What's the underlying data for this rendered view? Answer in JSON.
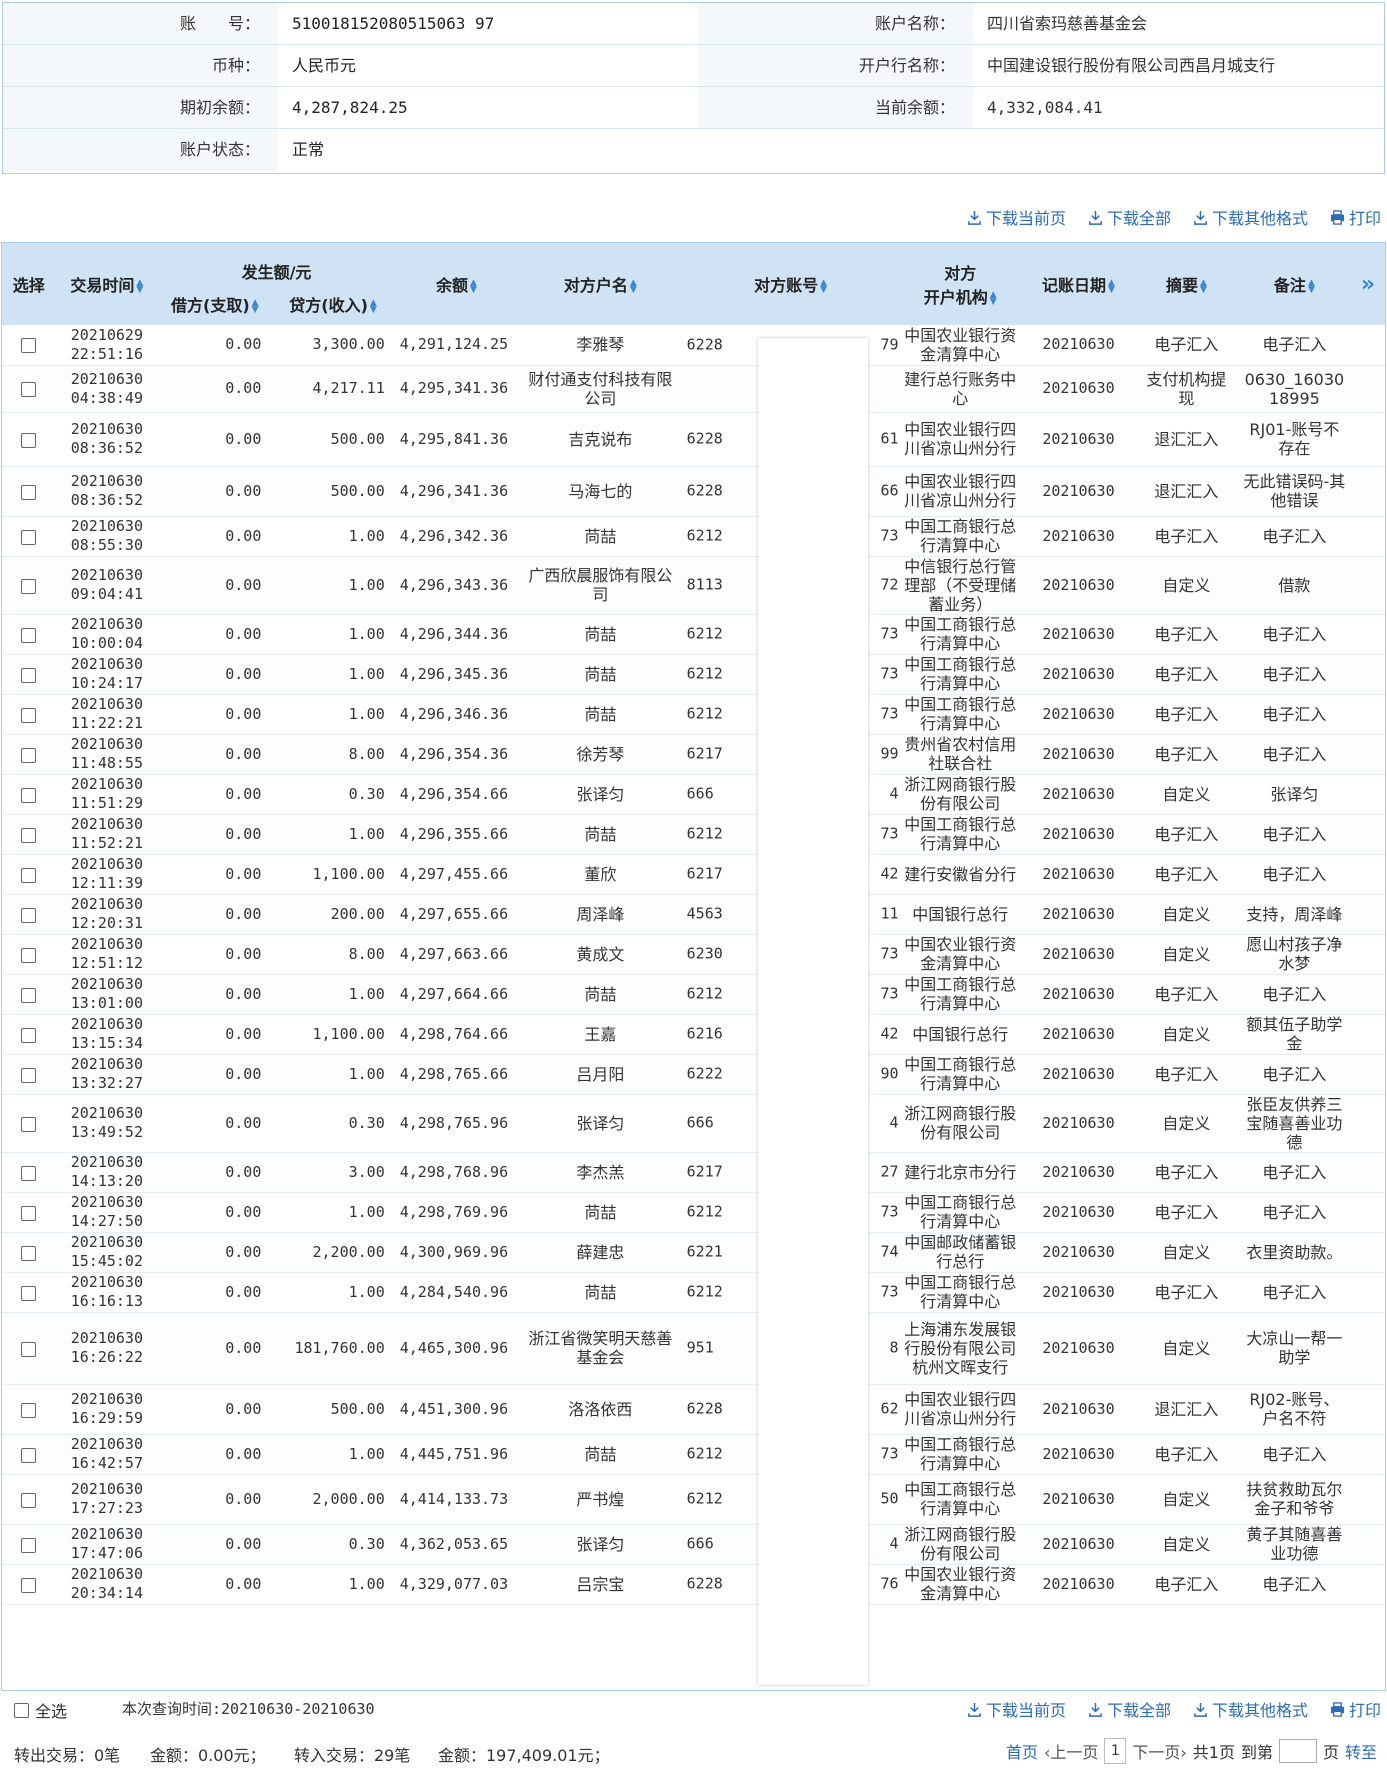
{
  "account": {
    "no_label": "账　　号：",
    "no_value": "510018152080515063 97",
    "name_label": "账户名称：",
    "name_value": "四川省索玛慈善基金会",
    "currency_label": "币种：",
    "currency_value": "人民币元",
    "bank_label": "开户行名称：",
    "bank_value": "中国建设银行股份有限公司西昌月城支行",
    "opening_label": "期初余额：",
    "opening_value": "4,287,824.25",
    "current_label": "当前余额：",
    "current_value": "4,332,084.41",
    "status_label": "账户状态：",
    "status_value": "正常"
  },
  "toolbar": {
    "download_page": "下载当前页",
    "download_all": "下载全部",
    "download_other": "下载其他格式",
    "print": "打印"
  },
  "table": {
    "headers": {
      "select": "选择",
      "time": "交易时间",
      "amount_group": "发生额/元",
      "debit": "借方(支取)",
      "credit": "贷方(收入)",
      "balance": "余额",
      "party": "对方户名",
      "party_account": "对方账号",
      "party_bank_1": "对方",
      "party_bank_2": "开户机构",
      "book_date": "记账日期",
      "summary": "摘要",
      "remark": "备注",
      "more": "»"
    },
    "rows": [
      {
        "d": "20210629",
        "t": "22:51:16",
        "debit": "0.00",
        "credit": "3,300.00",
        "bal": "4,291,124.25",
        "party": "李雅琴",
        "acct_l": "6228",
        "acct_r": "79",
        "bank": "中国农业银行资金清算中心",
        "date": "20210630",
        "sum": "电子汇入",
        "rem": "电子汇入"
      },
      {
        "d": "20210630",
        "t": "04:38:49",
        "debit": "0.00",
        "credit": "4,217.11",
        "bal": "4,295,341.36",
        "party": "财付通支付科技有限公司",
        "acct_l": "",
        "acct_r": "",
        "bank": "建行总行账务中心",
        "date": "20210630",
        "sum": "支付机构提现",
        "rem": "0630_16030 18995"
      },
      {
        "d": "20210630",
        "t": "08:36:52",
        "debit": "0.00",
        "credit": "500.00",
        "bal": "4,295,841.36",
        "party": "吉克说布",
        "acct_l": "6228",
        "acct_r": "61",
        "bank": "中国农业银行四川省凉山州分行",
        "date": "20210630",
        "sum": "退汇汇入",
        "rem": "RJ01-账号不存在"
      },
      {
        "d": "20210630",
        "t": "08:36:52",
        "debit": "0.00",
        "credit": "500.00",
        "bal": "4,296,341.36",
        "party": "马海七的",
        "acct_l": "6228",
        "acct_r": "66",
        "bank": "中国农业银行四川省凉山州分行",
        "date": "20210630",
        "sum": "退汇汇入",
        "rem": "无此错误码-其他错误"
      },
      {
        "d": "20210630",
        "t": "08:55:30",
        "debit": "0.00",
        "credit": "1.00",
        "bal": "4,296,342.36",
        "party": "苘喆",
        "acct_l": "6212",
        "acct_r": "73",
        "bank": "中国工商银行总行清算中心",
        "date": "20210630",
        "sum": "电子汇入",
        "rem": "电子汇入"
      },
      {
        "d": "20210630",
        "t": "09:04:41",
        "debit": "0.00",
        "credit": "1.00",
        "bal": "4,296,343.36",
        "party": "广西欣晨服饰有限公司",
        "acct_l": "8113",
        "acct_r": "72",
        "bank": "中信银行总行管理部（不受理储蓄业务）",
        "date": "20210630",
        "sum": "自定义",
        "rem": "借款"
      },
      {
        "d": "20210630",
        "t": "10:00:04",
        "debit": "0.00",
        "credit": "1.00",
        "bal": "4,296,344.36",
        "party": "苘喆",
        "acct_l": "6212",
        "acct_r": "73",
        "bank": "中国工商银行总行清算中心",
        "date": "20210630",
        "sum": "电子汇入",
        "rem": "电子汇入"
      },
      {
        "d": "20210630",
        "t": "10:24:17",
        "debit": "0.00",
        "credit": "1.00",
        "bal": "4,296,345.36",
        "party": "苘喆",
        "acct_l": "6212",
        "acct_r": "73",
        "bank": "中国工商银行总行清算中心",
        "date": "20210630",
        "sum": "电子汇入",
        "rem": "电子汇入"
      },
      {
        "d": "20210630",
        "t": "11:22:21",
        "debit": "0.00",
        "credit": "1.00",
        "bal": "4,296,346.36",
        "party": "苘喆",
        "acct_l": "6212",
        "acct_r": "73",
        "bank": "中国工商银行总行清算中心",
        "date": "20210630",
        "sum": "电子汇入",
        "rem": "电子汇入"
      },
      {
        "d": "20210630",
        "t": "11:48:55",
        "debit": "0.00",
        "credit": "8.00",
        "bal": "4,296,354.36",
        "party": "徐芳琴",
        "acct_l": "6217",
        "acct_r": "99",
        "bank": "贵州省农村信用社联合社",
        "date": "20210630",
        "sum": "电子汇入",
        "rem": "电子汇入"
      },
      {
        "d": "20210630",
        "t": "11:51:29",
        "debit": "0.00",
        "credit": "0.30",
        "bal": "4,296,354.66",
        "party": "张译匀",
        "acct_l": "666",
        "acct_r": "4",
        "bank": "浙江网商银行股份有限公司",
        "date": "20210630",
        "sum": "自定义",
        "rem": "张译匀"
      },
      {
        "d": "20210630",
        "t": "11:52:21",
        "debit": "0.00",
        "credit": "1.00",
        "bal": "4,296,355.66",
        "party": "苘喆",
        "acct_l": "6212",
        "acct_r": "73",
        "bank": "中国工商银行总行清算中心",
        "date": "20210630",
        "sum": "电子汇入",
        "rem": "电子汇入"
      },
      {
        "d": "20210630",
        "t": "12:11:39",
        "debit": "0.00",
        "credit": "1,100.00",
        "bal": "4,297,455.66",
        "party": "董欣",
        "acct_l": "6217",
        "acct_r": "42",
        "bank": "建行安徽省分行",
        "date": "20210630",
        "sum": "电子汇入",
        "rem": "电子汇入"
      },
      {
        "d": "20210630",
        "t": "12:20:31",
        "debit": "0.00",
        "credit": "200.00",
        "bal": "4,297,655.66",
        "party": "周泽峰",
        "acct_l": "4563",
        "acct_r": "11",
        "bank": "中国银行总行",
        "date": "20210630",
        "sum": "自定义",
        "rem": "支持，周泽峰"
      },
      {
        "d": "20210630",
        "t": "12:51:12",
        "debit": "0.00",
        "credit": "8.00",
        "bal": "4,297,663.66",
        "party": "黄成文",
        "acct_l": "6230",
        "acct_r": "73",
        "bank": "中国农业银行资金清算中心",
        "date": "20210630",
        "sum": "自定义",
        "rem": "愿山村孩子净水梦"
      },
      {
        "d": "20210630",
        "t": "13:01:00",
        "debit": "0.00",
        "credit": "1.00",
        "bal": "4,297,664.66",
        "party": "苘喆",
        "acct_l": "6212",
        "acct_r": "73",
        "bank": "中国工商银行总行清算中心",
        "date": "20210630",
        "sum": "电子汇入",
        "rem": "电子汇入"
      },
      {
        "d": "20210630",
        "t": "13:15:34",
        "debit": "0.00",
        "credit": "1,100.00",
        "bal": "4,298,764.66",
        "party": "王嘉",
        "acct_l": "6216",
        "acct_r": "42",
        "bank": "中国银行总行",
        "date": "20210630",
        "sum": "自定义",
        "rem": "额其伍子助学金"
      },
      {
        "d": "20210630",
        "t": "13:32:27",
        "debit": "0.00",
        "credit": "1.00",
        "bal": "4,298,765.66",
        "party": "吕月阳",
        "acct_l": "6222",
        "acct_r": "90",
        "bank": "中国工商银行总行清算中心",
        "date": "20210630",
        "sum": "电子汇入",
        "rem": "电子汇入"
      },
      {
        "d": "20210630",
        "t": "13:49:52",
        "debit": "0.00",
        "credit": "0.30",
        "bal": "4,298,765.96",
        "party": "张译匀",
        "acct_l": "666",
        "acct_r": "4",
        "bank": "浙江网商银行股份有限公司",
        "date": "20210630",
        "sum": "自定义",
        "rem": "张臣友供养三宝随喜善业功德"
      },
      {
        "d": "20210630",
        "t": "14:13:20",
        "debit": "0.00",
        "credit": "3.00",
        "bal": "4,298,768.96",
        "party": "李杰羔",
        "acct_l": "6217",
        "acct_r": "27",
        "bank": "建行北京市分行",
        "date": "20210630",
        "sum": "电子汇入",
        "rem": "电子汇入"
      },
      {
        "d": "20210630",
        "t": "14:27:50",
        "debit": "0.00",
        "credit": "1.00",
        "bal": "4,298,769.96",
        "party": "苘喆",
        "acct_l": "6212",
        "acct_r": "73",
        "bank": "中国工商银行总行清算中心",
        "date": "20210630",
        "sum": "电子汇入",
        "rem": "电子汇入"
      },
      {
        "d": "20210630",
        "t": "15:45:02",
        "debit": "0.00",
        "credit": "2,200.00",
        "bal": "4,300,969.96",
        "party": "薛建忠",
        "acct_l": "6221",
        "acct_r": "74",
        "bank": "中国邮政储蓄银行总行",
        "date": "20210630",
        "sum": "自定义",
        "rem": "衣里资助款。"
      },
      {
        "d": "20210630",
        "t": "16:16:13",
        "debit": "0.00",
        "credit": "1.00",
        "bal": "4,284,540.96",
        "party": "苘喆",
        "acct_l": "6212",
        "acct_r": "73",
        "bank": "中国工商银行总行清算中心",
        "date": "20210630",
        "sum": "电子汇入",
        "rem": "电子汇入"
      },
      {
        "d": "20210630",
        "t": "16:26:22",
        "debit": "0.00",
        "credit": "181,760.00",
        "bal": "4,465,300.96",
        "party": "浙江省微笑明天慈善基金会",
        "acct_l": "951",
        "acct_r": "8",
        "bank": "上海浦东发展银行股份有限公司杭州文晖支行",
        "date": "20210630",
        "sum": "自定义",
        "rem": "大凉山一帮一助学"
      },
      {
        "d": "20210630",
        "t": "16:29:59",
        "debit": "0.00",
        "credit": "500.00",
        "bal": "4,451,300.96",
        "party": "洛洛依西",
        "acct_l": "6228",
        "acct_r": "62",
        "bank": "中国农业银行四川省凉山州分行",
        "date": "20210630",
        "sum": "退汇汇入",
        "rem": "RJ02-账号、户名不符"
      },
      {
        "d": "20210630",
        "t": "16:42:57",
        "debit": "0.00",
        "credit": "1.00",
        "bal": "4,445,751.96",
        "party": "苘喆",
        "acct_l": "6212",
        "acct_r": "73",
        "bank": "中国工商银行总行清算中心",
        "date": "20210630",
        "sum": "电子汇入",
        "rem": "电子汇入"
      },
      {
        "d": "20210630",
        "t": "17:27:23",
        "debit": "0.00",
        "credit": "2,000.00",
        "bal": "4,414,133.73",
        "party": "严书煌",
        "acct_l": "6212",
        "acct_r": "50",
        "bank": "中国工商银行总行清算中心",
        "date": "20210630",
        "sum": "自定义",
        "rem": "扶贫救助瓦尔金子和爷爷"
      },
      {
        "d": "20210630",
        "t": "17:47:06",
        "debit": "0.00",
        "credit": "0.30",
        "bal": "4,362,053.65",
        "party": "张译匀",
        "acct_l": "666",
        "acct_r": "4",
        "bank": "浙江网商银行股份有限公司",
        "date": "20210630",
        "sum": "自定义",
        "rem": "黄子其随喜善业功德"
      },
      {
        "d": "20210630",
        "t": "20:34:14",
        "debit": "0.00",
        "credit": "1.00",
        "bal": "4,329,077.03",
        "party": "吕宗宝",
        "acct_l": "6228",
        "acct_r": "76",
        "bank": "中国农业银行资金清算中心",
        "date": "20210630",
        "sum": "电子汇入",
        "rem": "电子汇入"
      }
    ]
  },
  "footer": {
    "select_all": "全选",
    "query_time": "本次查询时间:20210630-20210630",
    "out_count": "转出交易：0笔",
    "out_amount": "金额：0.00元；",
    "in_count": "转入交易：29笔",
    "in_amount": "金额：197,409.01元；",
    "first": "首页",
    "prev": "‹上一页",
    "page": "1",
    "next": "下一页›",
    "total": "共1页",
    "goto": "到第",
    "page_unit": "页",
    "jump": "转至"
  }
}
